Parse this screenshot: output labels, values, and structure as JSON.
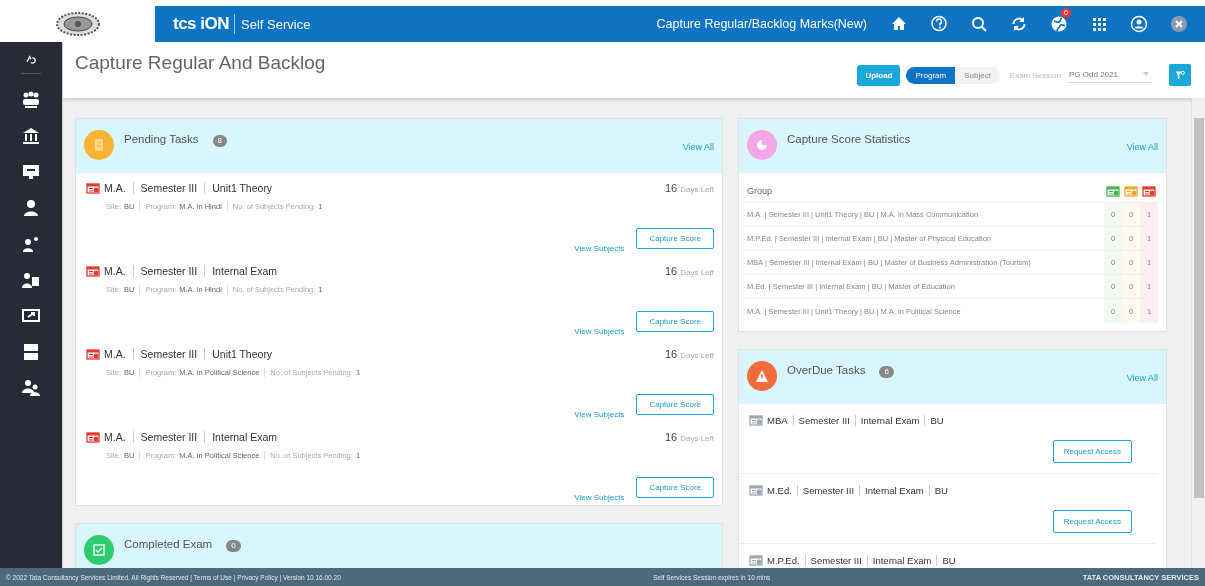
{
  "topbar": {
    "brand": "tcs iON",
    "product": "Self Service",
    "page_title": "Capture Regular/Backlog Marks(New)",
    "notification_count": "0"
  },
  "header": {
    "title": "Capture Regular And Backlog",
    "upload": "Upload",
    "toggle": [
      {
        "label": "Program",
        "selected": true
      },
      {
        "label": "Subject",
        "selected": false
      }
    ],
    "session_label": "Exam Session",
    "session_value": "PG Odd 2021"
  },
  "pending": {
    "title": "Pending Tasks",
    "count": "8",
    "view_all": "View All",
    "tasks": [
      {
        "parts": [
          "M.A.",
          "Semester III",
          "Unit1 Theory"
        ],
        "days": "16",
        "days_label": "Days Left",
        "details": [
          {
            "label": "Site:",
            "value": "BU"
          },
          {
            "label": "Program:",
            "value": "M.A. in Hindi"
          },
          {
            "label": "No. of Subjects Pending:",
            "value": "1"
          }
        ],
        "link": "View Subjects",
        "button": "Capture Score"
      },
      {
        "parts": [
          "M.A.",
          "Semester III",
          "Internal Exam"
        ],
        "days": "16",
        "days_label": "Days Left",
        "details": [
          {
            "label": "Site:",
            "value": "BU"
          },
          {
            "label": "Program:",
            "value": "M.A. in Hindi"
          },
          {
            "label": "No. of Subjects Pending:",
            "value": "1"
          }
        ],
        "link": "View Subjects",
        "button": "Capture Score"
      },
      {
        "parts": [
          "M.A.",
          "Semester III",
          "Unit1 Theory"
        ],
        "days": "16",
        "days_label": "Days Left",
        "details": [
          {
            "label": "Site:",
            "value": "BU"
          },
          {
            "label": "Program:",
            "value": "M.A. in Political Science"
          },
          {
            "label": "No. of Subjects Pending:",
            "value": "1"
          }
        ],
        "link": "View Subjects",
        "button": "Capture Score"
      },
      {
        "parts": [
          "M.A.",
          "Semester III",
          "Internal Exam"
        ],
        "days": "16",
        "days_label": "Days Left",
        "details": [
          {
            "label": "Site:",
            "value": "BU"
          },
          {
            "label": "Program:",
            "value": "M.A. in Political Science"
          },
          {
            "label": "No. of Subjects Pending:",
            "value": "1"
          }
        ],
        "link": "View Subjects",
        "button": "Capture Score"
      }
    ]
  },
  "completed": {
    "title": "Completed Exam",
    "count": "0"
  },
  "stats": {
    "title": "Capture Score Statistics",
    "view_all": "View All",
    "group_header": "Group",
    "columns": [
      {
        "color": "#4caf50"
      },
      {
        "color": "#f5a623"
      },
      {
        "color": "#e53935"
      }
    ],
    "rows": [
      {
        "group": "M.A. | Semester III | Unit1 Theory | BU | M.A. in Mass Communication",
        "counts": [
          "0",
          "0",
          "1"
        ]
      },
      {
        "group": "M.P.Ed. | Semester III | Internal Exam | BU | Master of Physical Education",
        "counts": [
          "0",
          "0",
          "1"
        ]
      },
      {
        "group": "MBA | Semester III | Internal Exam | BU | Master of Business Administration (Tourism)",
        "counts": [
          "0",
          "0",
          "1"
        ]
      },
      {
        "group": "M.Ed. | Semester III | Internal Exam | BU | Master of Education",
        "counts": [
          "0",
          "0",
          "1"
        ]
      },
      {
        "group": "M.A. | Semester III | Unit1 Theory | BU | M.A. in Political Science",
        "counts": [
          "0",
          "0",
          "1"
        ]
      }
    ]
  },
  "overdue": {
    "title": "OverDue Tasks",
    "count": "6",
    "view_all": "View All",
    "tasks": [
      {
        "parts": [
          "MBA",
          "Semester III",
          "Internal Exam",
          "BU"
        ],
        "button": "Request Access"
      },
      {
        "parts": [
          "M.Ed.",
          "Semester III",
          "Internal Exam",
          "BU"
        ],
        "button": "Request Access"
      },
      {
        "parts": [
          "M.P.Ed.",
          "Semester III",
          "Internal Exam",
          "BU"
        ]
      }
    ]
  },
  "footer": {
    "copyright": "© 2022 Tata Consultancy Services Limited. All Rights Reserved | Terms of Use | Privacy Policy | Version 10.16.00.20",
    "session": "Self Services Session expires in 10 mins",
    "company": "TATA CONSULTANCY SERVICES"
  }
}
